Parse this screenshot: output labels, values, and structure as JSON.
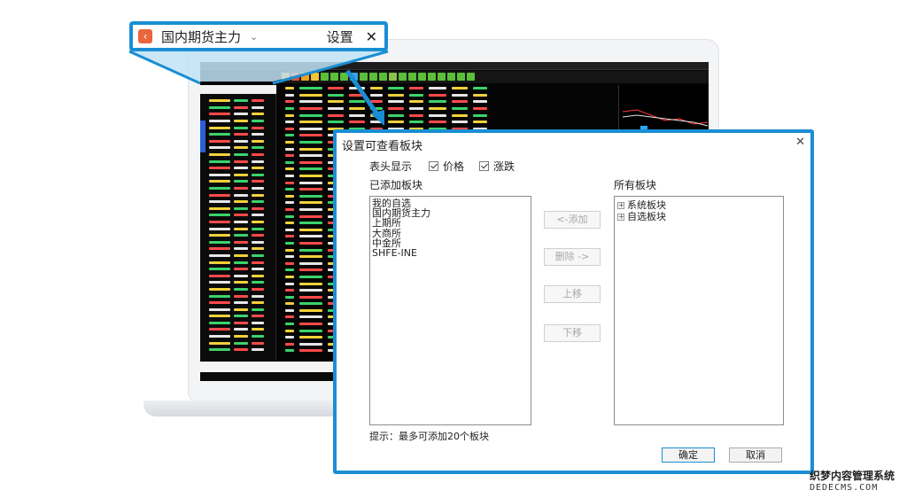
{
  "callout": {
    "back_icon": "chevron-left-icon",
    "title": "国内期货主力",
    "chevron_icon": "chevron-down-icon",
    "settings_label": "设置",
    "close_icon": "close-icon",
    "accent_color": "#1a8ed3"
  },
  "dialog": {
    "title": "设置可查看板块",
    "close_icon": "close-icon",
    "header_display_label": "表头显示",
    "checkboxes": [
      {
        "label": "价格",
        "checked": true
      },
      {
        "label": "涨跌",
        "checked": true
      }
    ],
    "added_label": "已添加板块",
    "added_items": [
      "我的自选",
      "国内期货主力",
      "上期所",
      "大商所",
      "中金所",
      "SHFE-INE"
    ],
    "all_label": "所有板块",
    "tree_items": [
      {
        "label": "系统板块",
        "expander": "+"
      },
      {
        "label": "自选板块",
        "expander": "+"
      }
    ],
    "buttons": {
      "add": "<-添加",
      "delete": "删除 ->",
      "up": "上移",
      "down": "下移",
      "ok": "确定",
      "cancel": "取消"
    },
    "hint": "提示：最多可添加20个板块"
  },
  "watermark": {
    "line1": "织梦内容管理系统",
    "line2": "DEDECMS.COM"
  }
}
